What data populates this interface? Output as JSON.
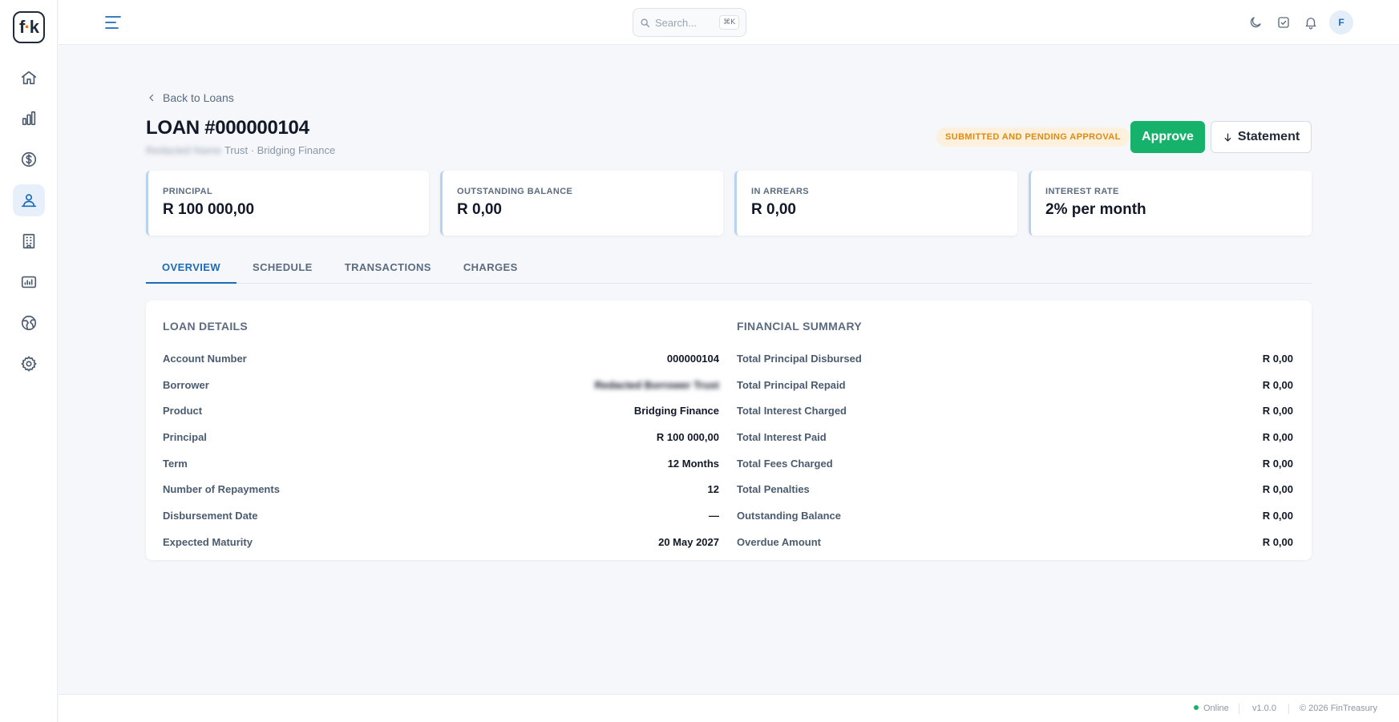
{
  "app": {
    "logo_text": "fk"
  },
  "search": {
    "placeholder": "Search...",
    "shortcut": "⌘K"
  },
  "user": {
    "initial": "F"
  },
  "breadcrumb": {
    "back_label": "Back to Loans"
  },
  "loan": {
    "title": "LOAN #000000104",
    "borrower_blurred": "Redacted Name",
    "subtitle_suffix": "Trust · Bridging Finance",
    "status": "SUBMITTED AND PENDING APPROVAL"
  },
  "actions": {
    "approve_label": "Approve",
    "statement_label": "Statement"
  },
  "stats": [
    {
      "label": "PRINCIPAL",
      "value": "R 100 000,00"
    },
    {
      "label": "OUTSTANDING BALANCE",
      "value": "R 0,00"
    },
    {
      "label": "IN ARREARS",
      "value": "R 0,00"
    },
    {
      "label": "INTEREST RATE",
      "value": "2% per month"
    }
  ],
  "tabs": [
    {
      "label": "OVERVIEW",
      "active": true
    },
    {
      "label": "SCHEDULE",
      "active": false
    },
    {
      "label": "TRANSACTIONS",
      "active": false
    },
    {
      "label": "CHARGES",
      "active": false
    }
  ],
  "loan_details": {
    "title": "LOAN DETAILS",
    "rows": [
      {
        "label": "Account Number",
        "value": "000000104"
      },
      {
        "label": "Borrower",
        "value": "Redacted Borrower Trust"
      },
      {
        "label": "Product",
        "value": "Bridging Finance"
      },
      {
        "label": "Principal",
        "value": "R 100 000,00"
      },
      {
        "label": "Term",
        "value": "12 Months"
      },
      {
        "label": "Number of Repayments",
        "value": "12"
      },
      {
        "label": "Disbursement Date",
        "value": "—"
      },
      {
        "label": "Expected Maturity",
        "value": "20 May 2027"
      }
    ]
  },
  "financial_summary": {
    "title": "FINANCIAL SUMMARY",
    "rows": [
      {
        "label": "Total Principal Disbursed",
        "value": "R 0,00"
      },
      {
        "label": "Total Principal Repaid",
        "value": "R 0,00"
      },
      {
        "label": "Total Interest Charged",
        "value": "R 0,00"
      },
      {
        "label": "Total Interest Paid",
        "value": "R 0,00"
      },
      {
        "label": "Total Fees Charged",
        "value": "R 0,00"
      },
      {
        "label": "Total Penalties",
        "value": "R 0,00"
      },
      {
        "label": "Outstanding Balance",
        "value": "R 0,00"
      },
      {
        "label": "Overdue Amount",
        "value": "R 0,00"
      }
    ]
  },
  "footer": {
    "status": "Online",
    "version": "v1.0.0",
    "copyright": "© 2026 FinTreasury"
  },
  "colors": {
    "accent": "#1c6bb8",
    "approve": "#16b26c",
    "status_badge_bg": "#fdf0dc",
    "status_badge_text": "#e08a10"
  }
}
